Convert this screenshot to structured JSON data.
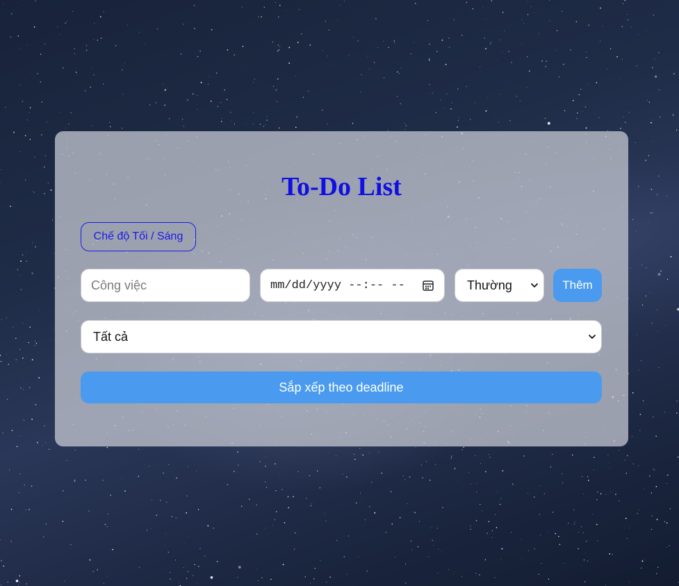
{
  "app": {
    "title": "To-Do List"
  },
  "theme_toggle": {
    "label": "Chế độ Tối / Sáng"
  },
  "form": {
    "task_placeholder": "Công việc",
    "task_value": "",
    "date_placeholder": "mm/dd/yyyy --:-- --",
    "priority_value": "Thường",
    "add_label": "Thêm"
  },
  "filter": {
    "value": "Tất cả"
  },
  "sort": {
    "label": "Sắp xếp theo deadline"
  },
  "icons": {
    "calendar": "calendar-icon",
    "chevron": "chevron-down-icon"
  },
  "colors": {
    "title": "#1010e0",
    "accent": "#4a9bef",
    "toggle": "#1a1ae6"
  }
}
